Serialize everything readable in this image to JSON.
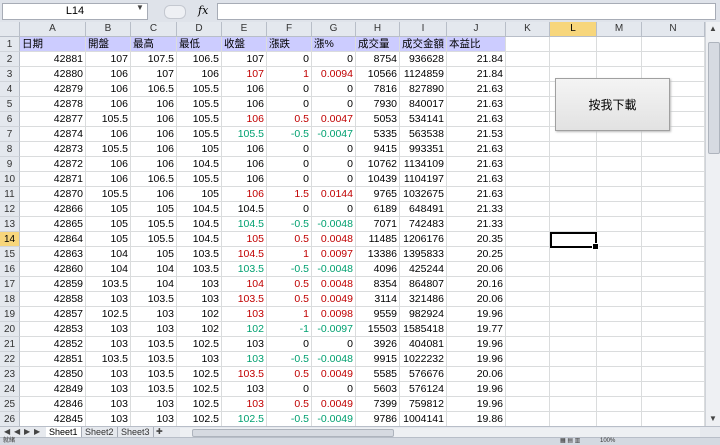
{
  "formula_bar": {
    "name_box": "L14",
    "fx_label": "fx",
    "formula": ""
  },
  "columns": [
    "A",
    "B",
    "C",
    "D",
    "E",
    "F",
    "G",
    "H",
    "I",
    "J",
    "K",
    "L",
    "M",
    "N"
  ],
  "selected_column": "L",
  "selected_row": 14,
  "headers": [
    "日期",
    "開盤",
    "最高",
    "最低",
    "收盤",
    "漲跌",
    "漲%",
    "成交量",
    "成交金額",
    "本益比"
  ],
  "rows": [
    {
      "n": "2",
      "c": [
        "42881",
        "107",
        "107.5",
        "106.5",
        "107",
        "0",
        "0",
        "8754",
        "936628",
        "21.84"
      ],
      "t": ""
    },
    {
      "n": "3",
      "c": [
        "42880",
        "106",
        "107",
        "106",
        "107",
        "1",
        "0.0094",
        "10566",
        "1124859",
        "21.84"
      ],
      "t": "red"
    },
    {
      "n": "4",
      "c": [
        "42879",
        "106",
        "106.5",
        "105.5",
        "106",
        "0",
        "0",
        "7816",
        "827890",
        "21.63"
      ],
      "t": ""
    },
    {
      "n": "5",
      "c": [
        "42878",
        "106",
        "106",
        "105.5",
        "106",
        "0",
        "0",
        "7930",
        "840017",
        "21.63"
      ],
      "t": ""
    },
    {
      "n": "6",
      "c": [
        "42877",
        "105.5",
        "106",
        "105.5",
        "106",
        "0.5",
        "0.0047",
        "5053",
        "534141",
        "21.63"
      ],
      "t": "red"
    },
    {
      "n": "7",
      "c": [
        "42874",
        "106",
        "106",
        "105.5",
        "105.5",
        "-0.5",
        "-0.0047",
        "5335",
        "563538",
        "21.53"
      ],
      "t": "green"
    },
    {
      "n": "8",
      "c": [
        "42873",
        "105.5",
        "106",
        "105",
        "106",
        "0",
        "0",
        "9415",
        "993351",
        "21.63"
      ],
      "t": ""
    },
    {
      "n": "9",
      "c": [
        "42872",
        "106",
        "106",
        "104.5",
        "106",
        "0",
        "0",
        "10762",
        "1134109",
        "21.63"
      ],
      "t": ""
    },
    {
      "n": "10",
      "c": [
        "42871",
        "106",
        "106.5",
        "105.5",
        "106",
        "0",
        "0",
        "10439",
        "1104197",
        "21.63"
      ],
      "t": ""
    },
    {
      "n": "11",
      "c": [
        "42870",
        "105.5",
        "106",
        "105",
        "106",
        "1.5",
        "0.0144",
        "9765",
        "1032675",
        "21.63"
      ],
      "t": "red"
    },
    {
      "n": "12",
      "c": [
        "42866",
        "105",
        "105",
        "104.5",
        "104.5",
        "0",
        "0",
        "6189",
        "648491",
        "21.33"
      ],
      "t": ""
    },
    {
      "n": "13",
      "c": [
        "42865",
        "105",
        "105.5",
        "104.5",
        "104.5",
        "-0.5",
        "-0.0048",
        "7071",
        "742483",
        "21.33"
      ],
      "t": "green"
    },
    {
      "n": "14",
      "c": [
        "42864",
        "105",
        "105.5",
        "104.5",
        "105",
        "0.5",
        "0.0048",
        "11485",
        "1206176",
        "20.35"
      ],
      "t": "red"
    },
    {
      "n": "15",
      "c": [
        "42863",
        "104",
        "105",
        "103.5",
        "104.5",
        "1",
        "0.0097",
        "13386",
        "1395833",
        "20.25"
      ],
      "t": "red"
    },
    {
      "n": "16",
      "c": [
        "42860",
        "104",
        "104",
        "103.5",
        "103.5",
        "-0.5",
        "-0.0048",
        "4096",
        "425244",
        "20.06"
      ],
      "t": "green"
    },
    {
      "n": "17",
      "c": [
        "42859",
        "103.5",
        "104",
        "103",
        "104",
        "0.5",
        "0.0048",
        "8354",
        "864807",
        "20.16"
      ],
      "t": "red"
    },
    {
      "n": "18",
      "c": [
        "42858",
        "103",
        "103.5",
        "103",
        "103.5",
        "0.5",
        "0.0049",
        "3114",
        "321486",
        "20.06"
      ],
      "t": "red"
    },
    {
      "n": "19",
      "c": [
        "42857",
        "102.5",
        "103",
        "102",
        "103",
        "1",
        "0.0098",
        "9559",
        "982924",
        "19.96"
      ],
      "t": "red"
    },
    {
      "n": "20",
      "c": [
        "42853",
        "103",
        "103",
        "102",
        "102",
        "-1",
        "-0.0097",
        "15503",
        "1585418",
        "19.77"
      ],
      "t": "green"
    },
    {
      "n": "21",
      "c": [
        "42852",
        "103",
        "103.5",
        "102.5",
        "103",
        "0",
        "0",
        "3926",
        "404081",
        "19.96"
      ],
      "t": ""
    },
    {
      "n": "22",
      "c": [
        "42851",
        "103.5",
        "103.5",
        "103",
        "103",
        "-0.5",
        "-0.0048",
        "9915",
        "1022232",
        "19.96"
      ],
      "t": "green"
    },
    {
      "n": "23",
      "c": [
        "42850",
        "103",
        "103.5",
        "102.5",
        "103.5",
        "0.5",
        "0.0049",
        "5585",
        "576676",
        "20.06"
      ],
      "t": "red"
    },
    {
      "n": "24",
      "c": [
        "42849",
        "103",
        "103.5",
        "102.5",
        "103",
        "0",
        "0",
        "5603",
        "576124",
        "19.96"
      ],
      "t": ""
    },
    {
      "n": "25",
      "c": [
        "42846",
        "103",
        "103",
        "102.5",
        "103",
        "0.5",
        "0.0049",
        "7399",
        "759812",
        "19.96"
      ],
      "t": "red"
    },
    {
      "n": "26",
      "c": [
        "42845",
        "103",
        "103",
        "102.5",
        "102.5",
        "-0.5",
        "-0.0049",
        "9786",
        "1004141",
        "19.86"
      ],
      "t": "green"
    }
  ],
  "button_label": "按我下載",
  "sheet_tabs": [
    "Sheet1",
    "Sheet2",
    "Sheet3"
  ],
  "status": {
    "ready": "就緒",
    "zoom": "100%"
  },
  "colors": {
    "header_fill": "#ccccff",
    "up": "#c00000",
    "down": "#00a070",
    "selection_header": "#f7d67c"
  }
}
